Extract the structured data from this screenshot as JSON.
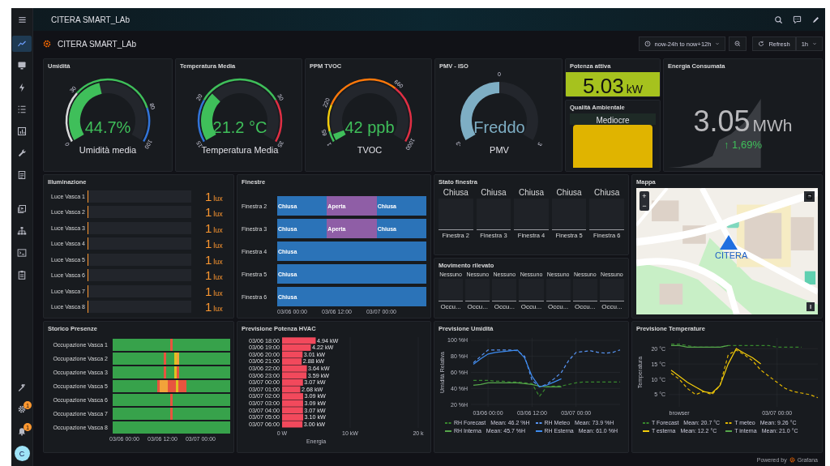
{
  "topbar": {
    "title": "CITERA SMART_LAb"
  },
  "sidebar": {
    "items": [
      {
        "selected": true
      },
      {
        "selected": false
      },
      {
        "selected": false
      },
      {
        "selected": false
      },
      {
        "selected": false
      },
      {
        "selected": false
      },
      {
        "selected": false
      }
    ],
    "tools": [
      {
        "selected": false
      },
      {
        "selected": false
      },
      {
        "selected": false
      },
      {
        "selected": false
      }
    ],
    "bottom": [
      {
        "selected": false
      },
      {
        "selected": false,
        "badge": "1"
      },
      {
        "selected": false,
        "badge": "1"
      }
    ],
    "avatar": "C"
  },
  "dashboard": {
    "title": "CITERA SMART_LAb",
    "time_range": "now-24h to now+12h",
    "refresh": "Refresh",
    "interval": "1h"
  },
  "gauges": [
    {
      "title": "Umidità",
      "value": "44.7%",
      "label": "Umidità media",
      "color": "#3fbf5a",
      "ticks": [
        "0",
        "30",
        "80",
        "100"
      ],
      "bands": [
        {
          "color": "#d8d9da"
        },
        {
          "color": "#3fbf5a"
        },
        {
          "color": "#3274d9"
        }
      ]
    },
    {
      "title": "Temperatura Media",
      "value": "21.2 °C",
      "label": "Temperatura Media",
      "color": "#3fbf5a",
      "ticks": [
        "15",
        "20",
        "30",
        "35"
      ],
      "bands": [
        {
          "color": "#3274d9"
        },
        {
          "color": "#3fbf5a"
        },
        {
          "color": "#e02f44"
        }
      ]
    },
    {
      "title": "PPM TVOC",
      "value": "42 ppb",
      "label": "TVOC",
      "color": "#3fbf5a",
      "ticks": [
        "1",
        "65",
        "220",
        "660",
        "1000"
      ],
      "bands": [
        {
          "color": "#3fbf5a"
        },
        {
          "color": "#f2cc0c"
        },
        {
          "color": "#ff780a"
        },
        {
          "color": "#e02f44"
        }
      ]
    },
    {
      "title": "PMV - ISO",
      "value": "Freddo",
      "label": "PMV",
      "color": "#7eaec4",
      "ticks": [
        "-3",
        "0",
        "3"
      ]
    }
  ],
  "power": {
    "title": "Potenza attiva",
    "value": "5.03",
    "unit": "kW",
    "color": "#a6c21e"
  },
  "quality": {
    "title": "Qualità Ambientale",
    "value": "Mediocre",
    "color": "#e0b400"
  },
  "energy": {
    "title": "Energia Consumata",
    "value": "3.05",
    "unit": "MWh",
    "change": "↑ 1,69%"
  },
  "lighting": {
    "title": "Illuminazione",
    "rows": [
      {
        "label": "Luce Vasca 1",
        "level": 0.01,
        "value": "1",
        "unit": "lux"
      },
      {
        "label": "Luce Vasca 2",
        "level": 0.01,
        "value": "1",
        "unit": "lux"
      },
      {
        "label": "Luce Vasca 3",
        "level": 0.01,
        "value": "1",
        "unit": "lux"
      },
      {
        "label": "Luce Vasca 4",
        "level": 0.01,
        "value": "1",
        "unit": "lux"
      },
      {
        "label": "Luce Vasca 5",
        "level": 0.01,
        "value": "1",
        "unit": "lux"
      },
      {
        "label": "Luce Vasca 6",
        "level": 0.01,
        "value": "1",
        "unit": "lux"
      },
      {
        "label": "Luce Vasca 7",
        "level": 0.01,
        "value": "1",
        "unit": "lux"
      },
      {
        "label": "Luce Vasca 8",
        "level": 0.01,
        "value": "1",
        "unit": "lux"
      }
    ]
  },
  "windows": {
    "title": "Finestre",
    "rows": [
      {
        "label": "Finestra 2",
        "segments": [
          {
            "label": "Chiusa",
            "color": "#2b73b8"
          },
          {
            "label": "Aperta",
            "color": "#8f5ea6"
          },
          {
            "label": "Chiusa",
            "color": "#2b73b8"
          }
        ]
      },
      {
        "label": "Finestra 3",
        "segments": [
          {
            "label": "Chiusa",
            "color": "#2b73b8"
          },
          {
            "label": "Aperta",
            "color": "#8f5ea6"
          },
          {
            "label": "Chiusa",
            "color": "#2b73b8"
          }
        ]
      },
      {
        "label": "Finestra 4",
        "segments": [
          {
            "label": "Chiusa",
            "color": "#2b73b8"
          }
        ]
      },
      {
        "label": "Finestra 5",
        "segments": [
          {
            "label": "Chiusa",
            "color": "#2b73b8"
          }
        ]
      },
      {
        "label": "Finestra 6",
        "segments": [
          {
            "label": "Chiusa",
            "color": "#2b73b8"
          }
        ]
      }
    ],
    "ticks": [
      "03/06 00:00",
      "03/06 12:00",
      "03/07 00:00"
    ]
  },
  "window_state": {
    "title": "Stato finestra",
    "tiles": [
      {
        "value": "Chiusa",
        "label": "Finestra 2"
      },
      {
        "value": "Chiusa",
        "label": "Finestra 3"
      },
      {
        "value": "Chiusa",
        "label": "Finestra 4"
      },
      {
        "value": "Chiusa",
        "label": "Finestra 5"
      },
      {
        "value": "Chiusa",
        "label": "Finestra 6"
      }
    ]
  },
  "motion": {
    "title": "Movimento rilevato",
    "tiles": [
      {
        "value": "Nessuno",
        "label": "Occu..."
      },
      {
        "value": "Nessuno",
        "label": "Occu..."
      },
      {
        "value": "Nessuno",
        "label": "Occu..."
      },
      {
        "value": "Nessuno",
        "label": "Occu..."
      },
      {
        "value": "Nessuno",
        "label": "Occu..."
      },
      {
        "value": "Nessuno",
        "label": "Occu..."
      },
      {
        "value": "Nessuno",
        "label": "Occu..."
      }
    ]
  },
  "map": {
    "title": "Mappa",
    "zoom_in": "+",
    "zoom_out": "−",
    "marker_label": "CITERA"
  },
  "presence": {
    "title": "Storico Presenze",
    "rows": [
      {
        "label": "Occupazione Vasca 1",
        "segments": [
          {
            "kind": "span",
            "color": "#37a24b"
          },
          {
            "kind": "mark",
            "color": "#e8543f"
          },
          {
            "kind": "span",
            "color": "#37a24b"
          }
        ]
      },
      {
        "label": "Occupazione Vasca 2",
        "segments": [
          {
            "kind": "span",
            "color": "#37a24b"
          },
          {
            "kind": "mark",
            "color": "#e8543f"
          },
          {
            "kind": "block",
            "color": "#37a24b"
          },
          {
            "kind": "mark",
            "color": "#e0c020"
          },
          {
            "kind": "mark",
            "color": "#f2a23a"
          },
          {
            "kind": "span",
            "color": "#37a24b"
          }
        ]
      },
      {
        "label": "Occupazione Vasca 3",
        "segments": [
          {
            "kind": "span",
            "color": "#37a24b"
          },
          {
            "kind": "mark",
            "color": "#e8543f"
          },
          {
            "kind": "block",
            "color": "#37a24b"
          },
          {
            "kind": "mark",
            "color": "#e0c020"
          },
          {
            "kind": "mark",
            "color": "#e8543f"
          },
          {
            "kind": "span",
            "color": "#37a24b"
          }
        ]
      },
      {
        "label": "Occupazione Vasca 5",
        "segments": [
          {
            "kind": "span",
            "color": "#37a24b"
          },
          {
            "kind": "mark",
            "color": "#e8543f"
          },
          {
            "kind": "block",
            "color": "#f2a23a"
          },
          {
            "kind": "block",
            "color": "#e8543f"
          },
          {
            "kind": "mark",
            "color": "#e0c020"
          },
          {
            "kind": "block",
            "color": "#e8543f"
          },
          {
            "kind": "span",
            "color": "#37a24b"
          }
        ]
      },
      {
        "label": "Occupazione Vasca 6",
        "segments": [
          {
            "kind": "span",
            "color": "#37a24b"
          },
          {
            "kind": "mark",
            "color": "#e8543f"
          },
          {
            "kind": "span",
            "color": "#37a24b"
          }
        ]
      },
      {
        "label": "Occupazione Vasca 7",
        "segments": [
          {
            "kind": "span",
            "color": "#37a24b"
          },
          {
            "kind": "mark",
            "color": "#e8543f"
          },
          {
            "kind": "span",
            "color": "#37a24b"
          }
        ]
      },
      {
        "label": "Occupazione Vasca 8",
        "segments": [
          {
            "kind": "span",
            "color": "#37a24b"
          }
        ]
      }
    ],
    "ticks": [
      "03/06 00:00",
      "03/06 12:00",
      "03/07 00:00"
    ]
  },
  "hvac": {
    "chart_data": {
      "type": "bar",
      "title": "Previsione Potenza HVAC",
      "orientation": "horizontal",
      "xlabel": "Energia",
      "categories": [
        "03/06 18:00",
        "03/06 19:00",
        "03/06 20:00",
        "03/06 21:00",
        "03/06 22:00",
        "03/06 23:00",
        "03/07 00:00",
        "03/07 01:00",
        "03/07 02:00",
        "03/07 03:00",
        "03/07 04:00",
        "03/07 05:00",
        "03/07 06:00"
      ],
      "values": [
        4.94,
        4.22,
        3.01,
        2.88,
        3.64,
        3.59,
        3.07,
        2.68,
        3.09,
        3.09,
        3.07,
        3.1,
        3.0
      ],
      "value_labels": [
        "4.94 kW",
        "4.22 kW",
        "3.01 kW",
        "2.88 kW",
        "3.64 kW",
        "3.59 kW",
        "3.07 kW",
        "2.68 kW",
        "3.09 kW",
        "3.09 kW",
        "3.07 kW",
        "3.10 kW",
        "3.00 kW"
      ],
      "xlim": [
        0,
        20
      ],
      "xticks": [
        {
          "value": 0,
          "label": "0 W"
        },
        {
          "value": 10,
          "label": "10 kW"
        },
        {
          "value": 20,
          "label": "20 k"
        }
      ]
    }
  },
  "humidity": {
    "chart_data": {
      "type": "line",
      "title": "Previsione Umidità",
      "ylabel": "Umidità Relativa",
      "categories": [
        null,
        null,
        "03/06 00:00",
        null,
        null,
        null,
        null,
        null,
        "03/06 12:00",
        null,
        null,
        null,
        null,
        null,
        "03/07 00:00",
        null,
        null,
        null,
        null,
        null,
        null
      ],
      "series": [
        {
          "name": "RH Forecast",
          "color": "#37872d",
          "line_style": "dashed",
          "values": [
            50,
            50,
            50,
            49,
            49,
            48,
            48,
            47,
            46,
            30,
            42,
            43,
            43,
            45,
            47,
            48,
            48,
            48,
            48,
            48,
            48
          ]
        },
        {
          "name": "RH Meteo",
          "color": "#5794f2",
          "line_style": "dashed",
          "values": [
            72,
            80,
            88,
            88,
            88,
            88,
            87,
            80,
            50,
            42,
            45,
            52,
            60,
            75,
            85,
            86,
            87,
            85,
            84,
            85,
            88
          ]
        },
        {
          "name": "RH Interna",
          "color": "#56a64b",
          "line_style": "solid",
          "values": [
            44,
            45,
            47,
            47,
            47,
            47,
            47,
            46,
            45,
            43,
            42,
            42,
            42,
            null,
            null,
            null,
            null,
            null,
            null,
            null,
            null
          ]
        },
        {
          "name": "RH Esterna",
          "color": "#3d8cf0",
          "line_style": "solid",
          "values": [
            70,
            77,
            83,
            85,
            86,
            87,
            88,
            78,
            55,
            42,
            44,
            48,
            52,
            null,
            null,
            null,
            null,
            null,
            null,
            null,
            null
          ]
        }
      ],
      "ylim": [
        17,
        103
      ],
      "grid": true,
      "legend": true,
      "yticks": [
        {
          "value": 20,
          "label": "20 %H"
        },
        {
          "value": 40,
          "label": "40 %H"
        },
        {
          "value": 60,
          "label": "60 %H"
        },
        {
          "value": 80,
          "label": "80 %H"
        },
        {
          "value": 100,
          "label": "100 %H"
        }
      ]
    },
    "legend_means": [
      "Mean: 46.2 %H",
      "Mean: 73.9 %H",
      "Mean: 45.7 %H",
      "Mean: 61.0 %H"
    ]
  },
  "temperature": {
    "chart_data": {
      "type": "line",
      "title": "Previsione Temperature",
      "ylabel": "Temperatura",
      "categories": [
        null,
        "browser",
        null,
        null,
        null,
        null,
        null,
        null,
        null,
        null,
        null,
        null,
        null,
        "03/07 00:00",
        null,
        null,
        null,
        null,
        null
      ],
      "series": [
        {
          "name": "T Forecast",
          "color": "#37872d",
          "line_style": "dashed",
          "values": [
            21.5,
            21.5,
            21,
            20.5,
            20.5,
            20.5,
            20.5,
            21,
            21,
            21,
            21,
            21,
            21,
            20.5,
            20.5,
            20.5,
            20.5,
            null,
            null
          ]
        },
        {
          "name": "T meteo",
          "color": "#e0b400",
          "line_style": "dashed",
          "values": [
            12,
            10,
            7,
            5,
            6,
            5,
            8,
            18,
            19.5,
            18,
            16,
            13,
            11,
            9,
            7,
            6,
            5.5,
            5,
            4
          ]
        },
        {
          "name": "T esterna",
          "color": "#f2cc0c",
          "line_style": "solid",
          "values": [
            13,
            11,
            9,
            7.5,
            6,
            5.5,
            8,
            15,
            20,
            18.5,
            17,
            15,
            null,
            null,
            null,
            null,
            null,
            null,
            null
          ]
        },
        {
          "name": "T interna",
          "color": "#56a64b",
          "line_style": "solid",
          "values": [
            21,
            21,
            20.5,
            20.5,
            20.5,
            20.5,
            20.5,
            21,
            null,
            null,
            null,
            null,
            null,
            null,
            null,
            null,
            null,
            null,
            null
          ]
        }
      ],
      "ylim": [
        1,
        23.5
      ],
      "grid": true,
      "legend": true,
      "yticks": [
        {
          "value": 5,
          "label": "5 °C"
        },
        {
          "value": 10,
          "label": "10 °C"
        },
        {
          "value": 15,
          "label": "15 °C"
        },
        {
          "value": 20,
          "label": "20 °C"
        }
      ]
    },
    "legend_means": [
      "Mean: 20.7 °C",
      "Mean: 9.26 °C",
      "Mean: 12.2 °C",
      "Mean: 21.0 °C"
    ]
  },
  "footer": {
    "text": "Powered by",
    "brand": "Grafana"
  }
}
